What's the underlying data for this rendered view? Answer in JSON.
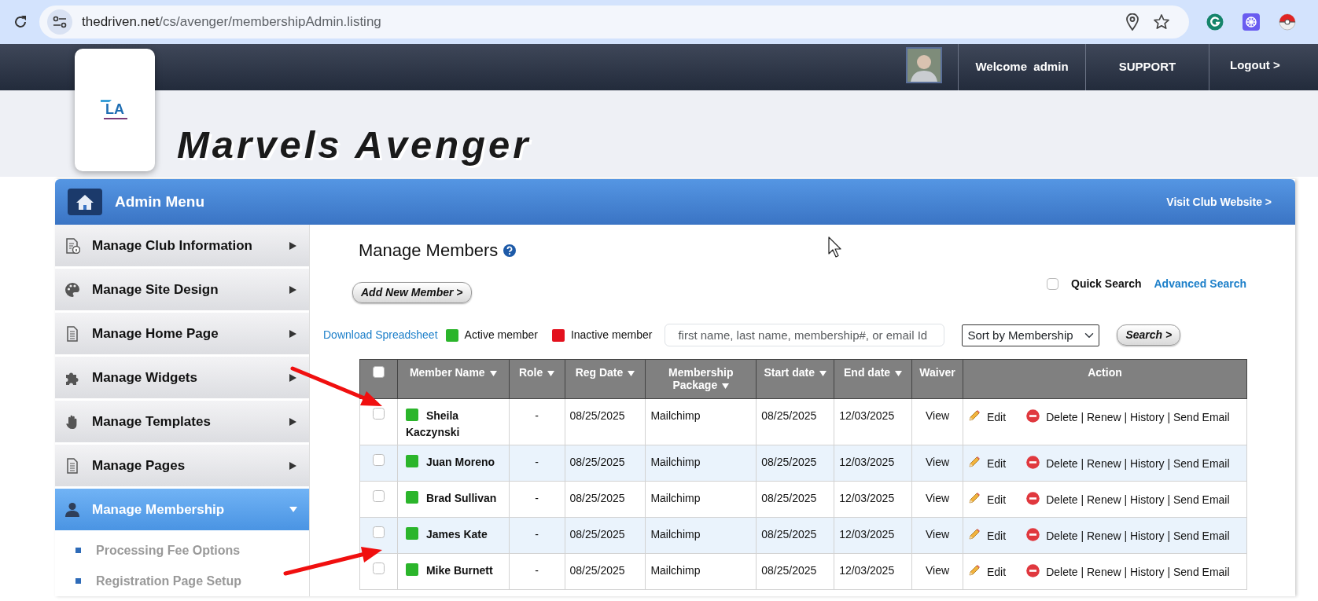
{
  "browser": {
    "host": "thedriven.net",
    "path": "/cs/avenger/membershipAdmin.listing"
  },
  "header": {
    "welcome": "Welcome",
    "user": "admin",
    "support": "SUPPORT",
    "logout": "Logout >"
  },
  "logo": {
    "text": "LA"
  },
  "site_title": "Marvels Avenger",
  "admin_menu": {
    "title": "Admin Menu",
    "visit_link": "Visit Club Website >"
  },
  "sidebar": {
    "items": [
      {
        "label": "Manage Club Information",
        "selected": false,
        "expanded": false
      },
      {
        "label": "Manage Site Design",
        "selected": false,
        "expanded": false
      },
      {
        "label": "Manage Home Page",
        "selected": false,
        "expanded": false
      },
      {
        "label": "Manage Widgets",
        "selected": false,
        "expanded": false
      },
      {
        "label": "Manage Templates",
        "selected": false,
        "expanded": false
      },
      {
        "label": "Manage Pages",
        "selected": false,
        "expanded": false
      },
      {
        "label": "Manage Membership",
        "selected": true,
        "expanded": true,
        "children": [
          {
            "label": "Processing Fee Options"
          },
          {
            "label": "Registration Page Setup"
          }
        ]
      }
    ]
  },
  "content": {
    "title": "Manage Members",
    "add_button": "Add New Member >",
    "quick_search": {
      "label": "Quick Search",
      "checked": false
    },
    "advanced_search": "Advanced Search",
    "download_link": "Download Spreadsheet",
    "legend": [
      {
        "label": "Active member",
        "color": "#2bb52b"
      },
      {
        "label": "Inactive member",
        "color": "#e3101d"
      }
    ],
    "search": {
      "placeholder": "first name, last name, membership#, or email Id"
    },
    "sort": {
      "value": "Sort by Membership"
    },
    "search_button": "Search >"
  },
  "table": {
    "select_all": {
      "checked": false
    },
    "columns": [
      {
        "label": "Member Name",
        "sortable": true
      },
      {
        "label": "Role",
        "sortable": true
      },
      {
        "label": "Reg Date",
        "sortable": true
      },
      {
        "label": "Membership Package",
        "sortable": true
      },
      {
        "label": "Start date",
        "sortable": true
      },
      {
        "label": "End date",
        "sortable": true
      },
      {
        "label": "Waiver",
        "sortable": false
      },
      {
        "label": "Action",
        "sortable": false
      }
    ],
    "rows": [
      {
        "checked": false,
        "color": "#2bb52b",
        "name": "Sheila Kaczynski",
        "role": "-",
        "reg_date": "08/25/2025",
        "package": "Mailchimp",
        "start_date": "08/25/2025",
        "end_date": "12/03/2025",
        "waiver": "View",
        "edit": "Edit",
        "links": "Delete | Renew | History | Send Email"
      },
      {
        "checked": false,
        "color": "#2bb52b",
        "name": "Juan Moreno",
        "role": "-",
        "reg_date": "08/25/2025",
        "package": "Mailchimp",
        "start_date": "08/25/2025",
        "end_date": "12/03/2025",
        "waiver": "View",
        "edit": "Edit",
        "links": "Delete | Renew | History | Send Email"
      },
      {
        "checked": false,
        "color": "#2bb52b",
        "name": "Brad Sullivan",
        "role": "-",
        "reg_date": "08/25/2025",
        "package": "Mailchimp",
        "start_date": "08/25/2025",
        "end_date": "12/03/2025",
        "waiver": "View",
        "edit": "Edit",
        "links": "Delete | Renew | History | Send Email"
      },
      {
        "checked": false,
        "color": "#2bb52b",
        "name": "James Kate",
        "role": "-",
        "reg_date": "08/25/2025",
        "package": "Mailchimp",
        "start_date": "08/25/2025",
        "end_date": "12/03/2025",
        "waiver": "View",
        "edit": "Edit",
        "links": "Delete | Renew | History | Send Email"
      },
      {
        "checked": false,
        "color": "#2bb52b",
        "name": "Mike Burnett",
        "role": "-",
        "reg_date": "08/25/2025",
        "package": "Mailchimp",
        "start_date": "08/25/2025",
        "end_date": "12/03/2025",
        "waiver": "View",
        "edit": "Edit",
        "links": "Delete | Renew | History | Send Email"
      }
    ]
  }
}
